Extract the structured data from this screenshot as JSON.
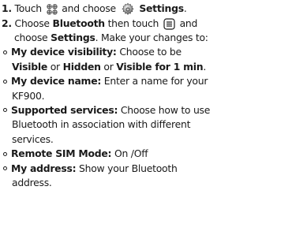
{
  "steps": [
    {
      "num": "1.",
      "text_before_icon": "Touch",
      "icon_menu": "grid-menu-icon",
      "text_mid": "and choose",
      "icon_settings": "settings-gear-icon",
      "bold_text": "Settings",
      "text_end": "."
    },
    {
      "num": "2.",
      "text_1": "Choose",
      "bold_1": "Bluetooth",
      "text_2": "then touch",
      "icon_options": "options-menu-icon",
      "text_3": "and",
      "text_4": "choose",
      "bold_2": "Settings",
      "text_5": ". Make your changes to:"
    }
  ],
  "bullets": [
    {
      "label": "My device visibility:",
      "t1": "Choose to be",
      "b1": "Visible",
      "t2": "or",
      "b2": "Hidden",
      "t3": "or",
      "b3": "Visible for 1 min",
      "t4": "."
    },
    {
      "label": "My device name:",
      "t1": "Enter a name for your",
      "t2": "KF900."
    },
    {
      "label": "Supported services:",
      "t1": "Choose how to use",
      "t2": "Bluetooth in association with different",
      "t3": "services."
    },
    {
      "label": "Remote SIM Mode:",
      "t1": "On /Off"
    },
    {
      "label": "My address:",
      "t1": "Show your Bluetooth",
      "t2": "address."
    }
  ]
}
